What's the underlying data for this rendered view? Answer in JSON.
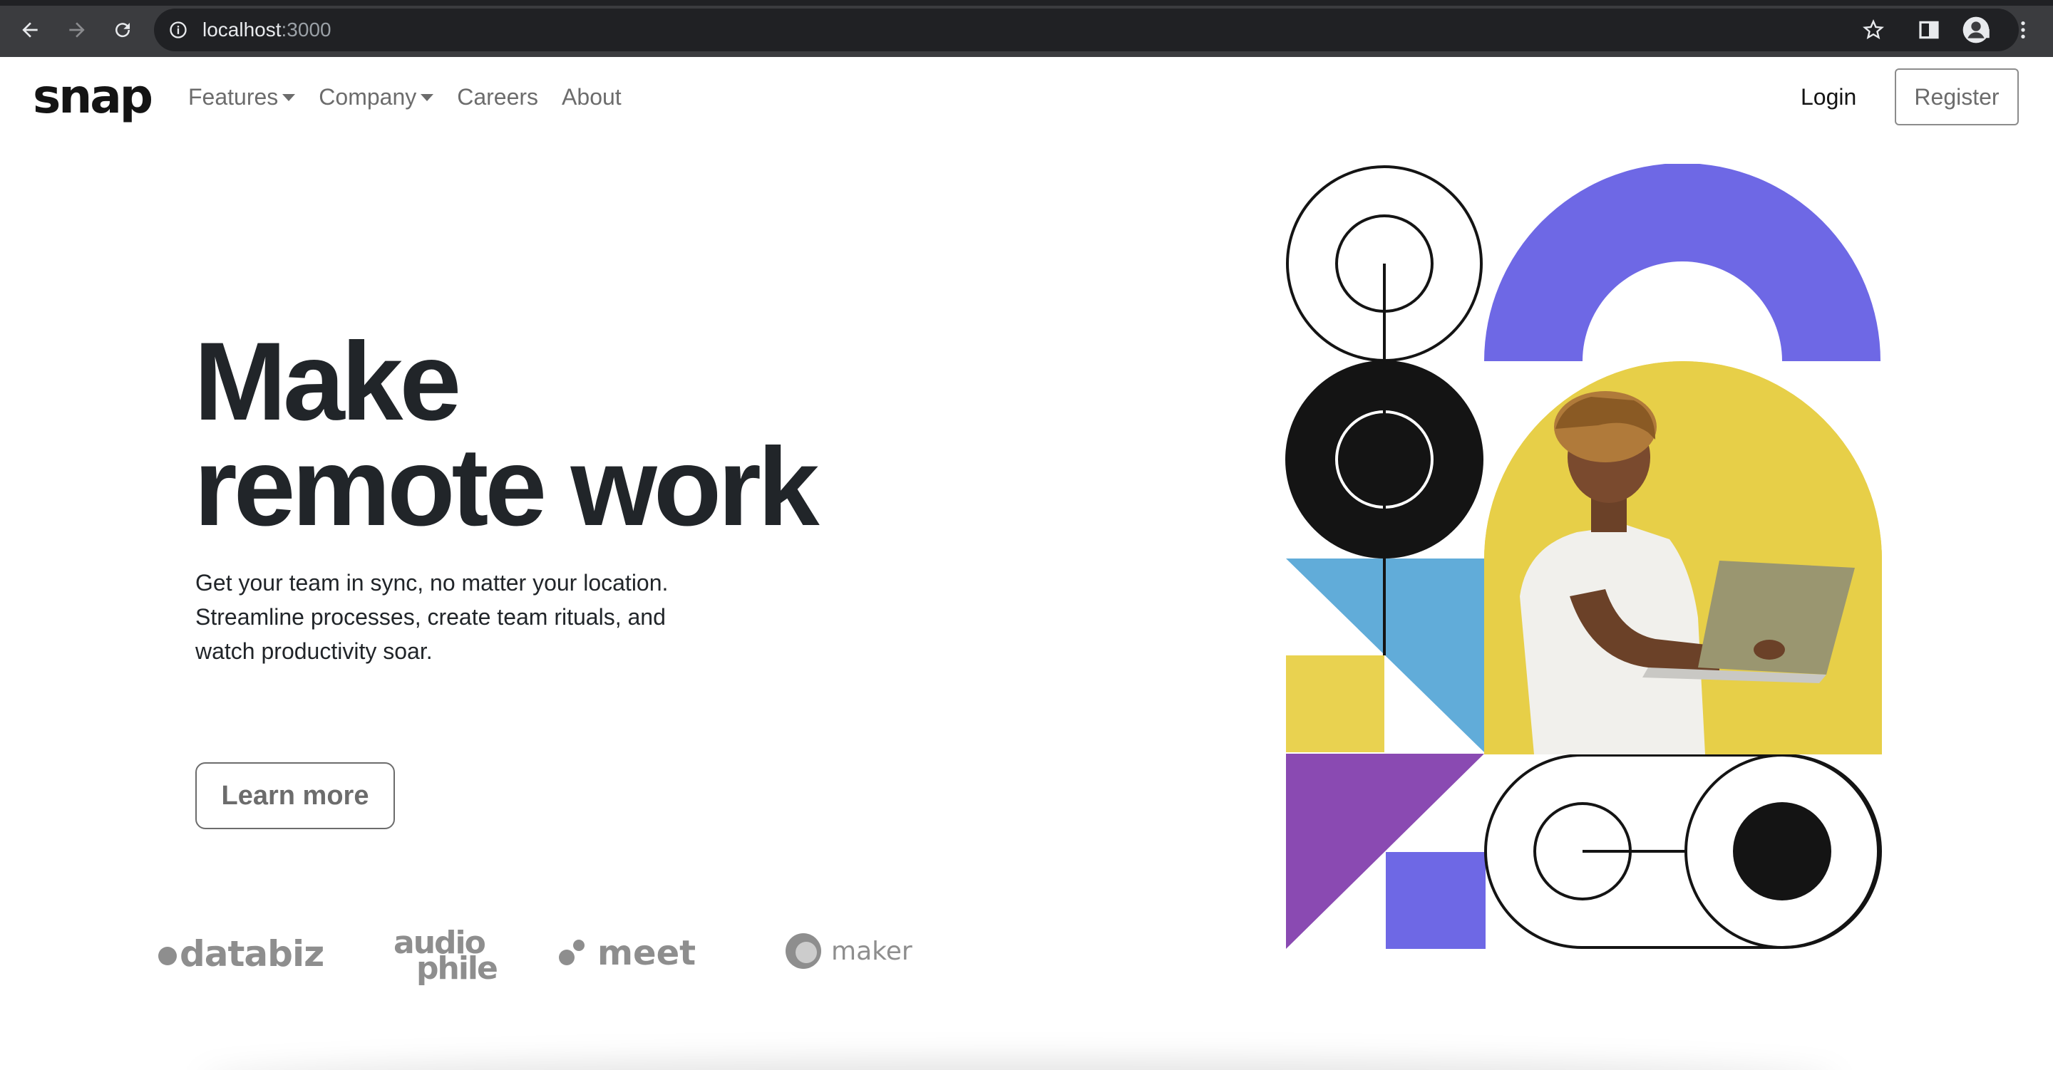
{
  "browser": {
    "url_host": "localhost",
    "url_port": ":3000"
  },
  "navbar": {
    "logo": "snap",
    "links": [
      {
        "label": "Features",
        "dropdown": true
      },
      {
        "label": "Company",
        "dropdown": true
      },
      {
        "label": "Careers",
        "dropdown": false
      },
      {
        "label": "About",
        "dropdown": false
      }
    ],
    "login_label": "Login",
    "register_label": "Register"
  },
  "hero": {
    "title_line1": "Make",
    "title_line2": "remote work",
    "description": "Get your team in sync, no matter your location. Streamline processes, create team rituals, and watch productivity soar.",
    "cta_label": "Learn more"
  },
  "partners": {
    "databiz": "databiz",
    "audiophile_line1": "audio",
    "audiophile_line2": "phile",
    "meet": "meet",
    "maker": "maker"
  },
  "colors": {
    "text_dark": "#212529",
    "muted": "#6c6c6c",
    "purple": "#6e68e5",
    "violet": "#8a4ab2",
    "blue": "#61acd9",
    "yellow": "#e9d250",
    "black": "#141414"
  }
}
